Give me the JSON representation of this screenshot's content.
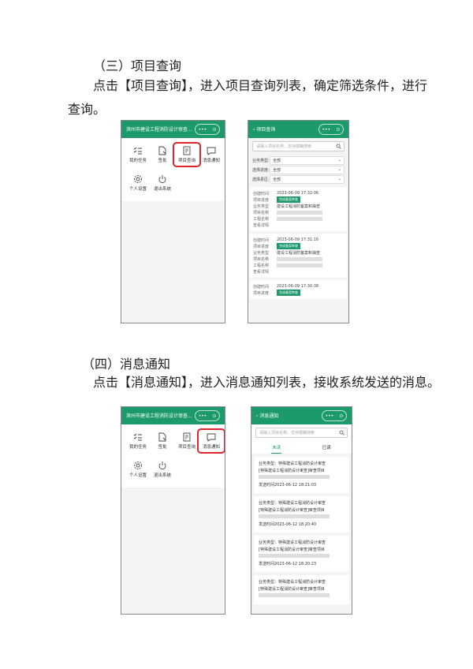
{
  "section3": {
    "heading": "（三）项目查询",
    "line1": "点击【项目查询】，进入项目查询列表，确定筛选条件，进行",
    "line2": "查询。"
  },
  "section4": {
    "heading": "（四）消息通知",
    "line1": "点击【消息通知】，进入消息通知列表，接收系统发送的消息。"
  },
  "home": {
    "title": "滨州市建设工程消防设计审查...",
    "tiles": [
      "我的任务",
      "签批",
      "项目查询",
      "消息通知",
      "个人设置",
      "退出系统"
    ]
  },
  "capsule": {
    "dots": "•••",
    "target": "⊙"
  },
  "query": {
    "back": "‹",
    "title": "项目查询",
    "search_placeholder": "请输入项目名称、支持模糊搜索",
    "filters": [
      {
        "label": "业务类型:",
        "value": "全部"
      },
      {
        "label": "选择进度:",
        "value": "全部"
      },
      {
        "label": "选择县区:",
        "value": "全部"
      }
    ],
    "k_time": "创建时间",
    "k_progress": "项目进度",
    "k_type": "业务类型",
    "k_name": "项目名称",
    "k_proj": "工程名称",
    "detail": "查看详情",
    "tag": "完成备案审查",
    "biz": "建设工程消防备案和抽查",
    "cards": [
      {
        "time": "2023-06-09 17:32:06"
      },
      {
        "time": "2023-06-09 17:31:16"
      },
      {
        "time": "2023-06-09 17:30:38"
      }
    ]
  },
  "notify": {
    "back": "‹",
    "title": "消息通知",
    "search_placeholder": "请输入项目名称、支持模糊搜索",
    "tab_unread": "未读",
    "tab_read": "已读",
    "biz_line": "业务类型：特殊建设工程消防设计审查",
    "proj_line": "[特殊建设工程消防设计审查]审查项目",
    "messages": [
      {
        "time": "发送时间2023-06-12 18:21:03"
      },
      {
        "time": "发送时间2023-06-12 18:20:40"
      },
      {
        "time": "发送时间2023-06-12 18:20:23"
      },
      {
        "time": ""
      }
    ]
  }
}
